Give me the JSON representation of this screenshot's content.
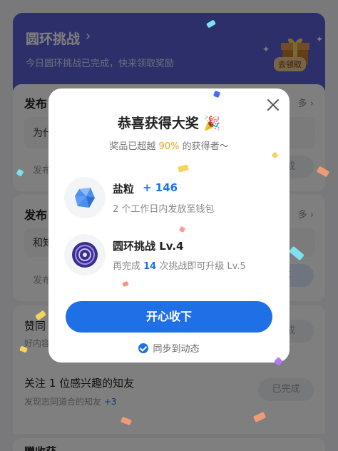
{
  "background": {
    "header": {
      "title": "圆环挑战",
      "arrow": "›",
      "subtitle": "今日圆环挑战已完成，快来领取奖励",
      "gift_badge": "去领取"
    },
    "card1": {
      "title": "发布",
      "more": "多 ›",
      "inner_text": "为什",
      "footer_left": "发布",
      "button": "完成"
    },
    "card2": {
      "title": "发布",
      "more": "多 ›",
      "inner_text": "和知",
      "footer_left": "发布",
      "button": "成"
    },
    "task_like": {
      "title": "赞同",
      "sub": "好内容",
      "button": "完成"
    },
    "task_follow": {
      "title": "关注 1 位感兴趣的知友",
      "sub": "发现志同道合的知友",
      "sub_extra": "+3",
      "button": "已完成"
    },
    "bottom_title": "赠收获"
  },
  "modal": {
    "title": "恭喜获得大奖",
    "title_emoji": "🎉",
    "subtitle_prefix": "奖品已超越 ",
    "subtitle_pct": "90%",
    "subtitle_suffix": " 的获得者～",
    "rewards": [
      {
        "name": "盐粒",
        "amount": "+ 146",
        "desc": "2 个工作日内发放至钱包"
      },
      {
        "name": "圆环挑战 Lv.4",
        "desc_prefix": "再完成 ",
        "desc_num": "14",
        "desc_suffix": " 次挑战即可升级 Lv.5"
      }
    ],
    "primary_button": "开心收下",
    "sync_label": "同步到动态"
  },
  "colors": {
    "brand_blue": "#1f6fe6",
    "header_purple": "#5b5fd6",
    "accent_orange": "#f0a020"
  },
  "icons": [
    "chevron-right-icon",
    "gift-icon",
    "close-icon",
    "salt-crystal-icon",
    "ring-challenge-badge-icon",
    "check-circle-icon",
    "party-popper-icon"
  ]
}
